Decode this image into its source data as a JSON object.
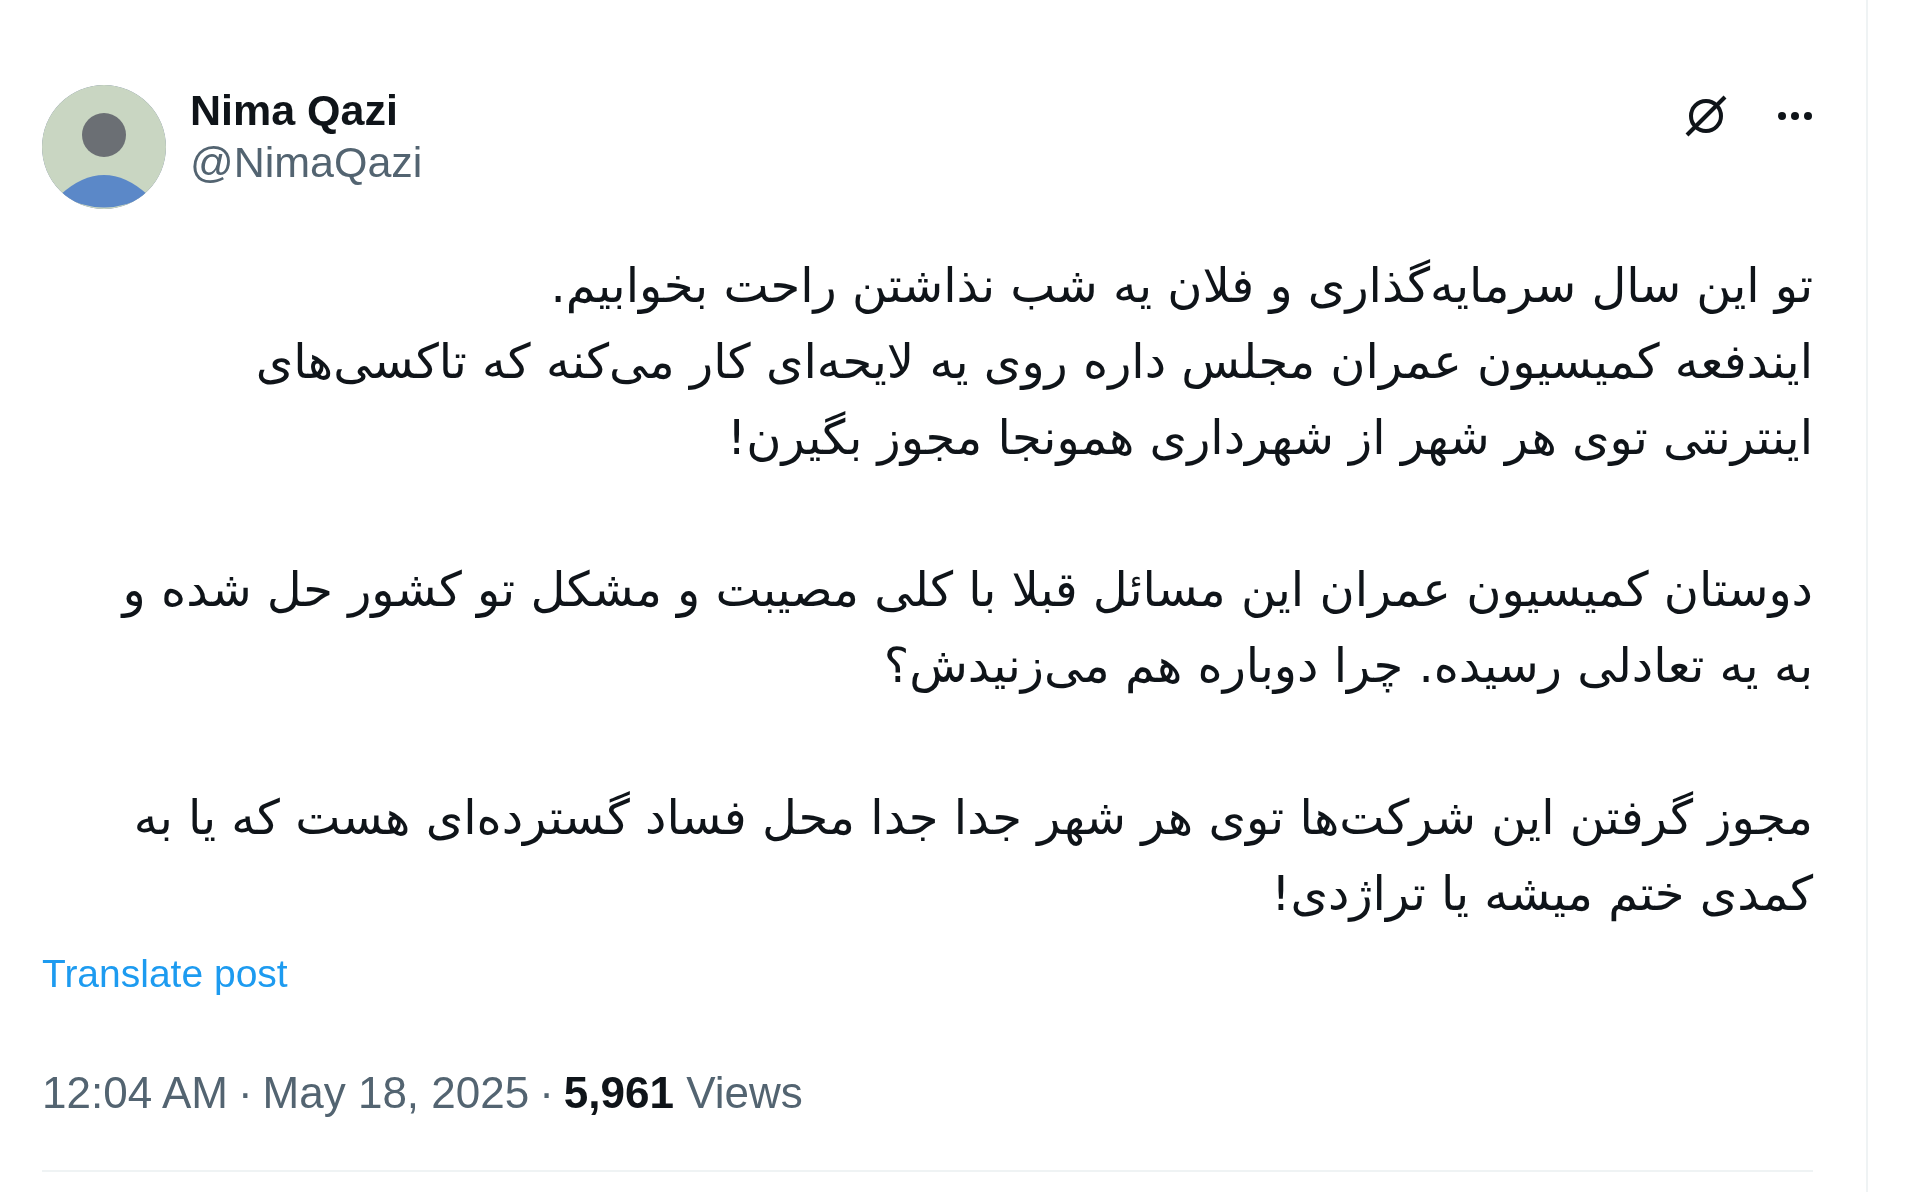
{
  "author": {
    "name": "Nima Qazi",
    "handle": "@NimaQazi"
  },
  "post": {
    "paragraphs": [
      [
        "تو این سال سرمایه‌گذاری و فلان یه شب نذاشتن راحت بخوابیم.",
        "ایندفعه کمیسیون عمران مجلس داره روی یه لایحه‌ای کار می‌کنه که تاکسی‌های",
        "اینترنتی توی هر شهر از شهرداری همونجا مجوز بگیرن!"
      ],
      [
        "دوستان کمیسیون عمران این مسائل قبلا با کلی مصیبت و مشکل تو کشور حل شده و",
        "به یه تعادلی رسیده. چرا دوباره هم می‌زنیدش؟"
      ],
      [
        "مجوز گرفتن این شرکت‌ها توی هر شهر جدا جدا محل فساد گسترده‌ای هست که یا به",
        "کمدی ختم میشه یا تراژدی!"
      ]
    ]
  },
  "translate_link": "Translate post",
  "meta": {
    "time": "12:04 AM",
    "separator_1": "·",
    "date": "May 18, 2025",
    "separator_2": "·",
    "views_count": "5,961",
    "views_label": "Views"
  }
}
